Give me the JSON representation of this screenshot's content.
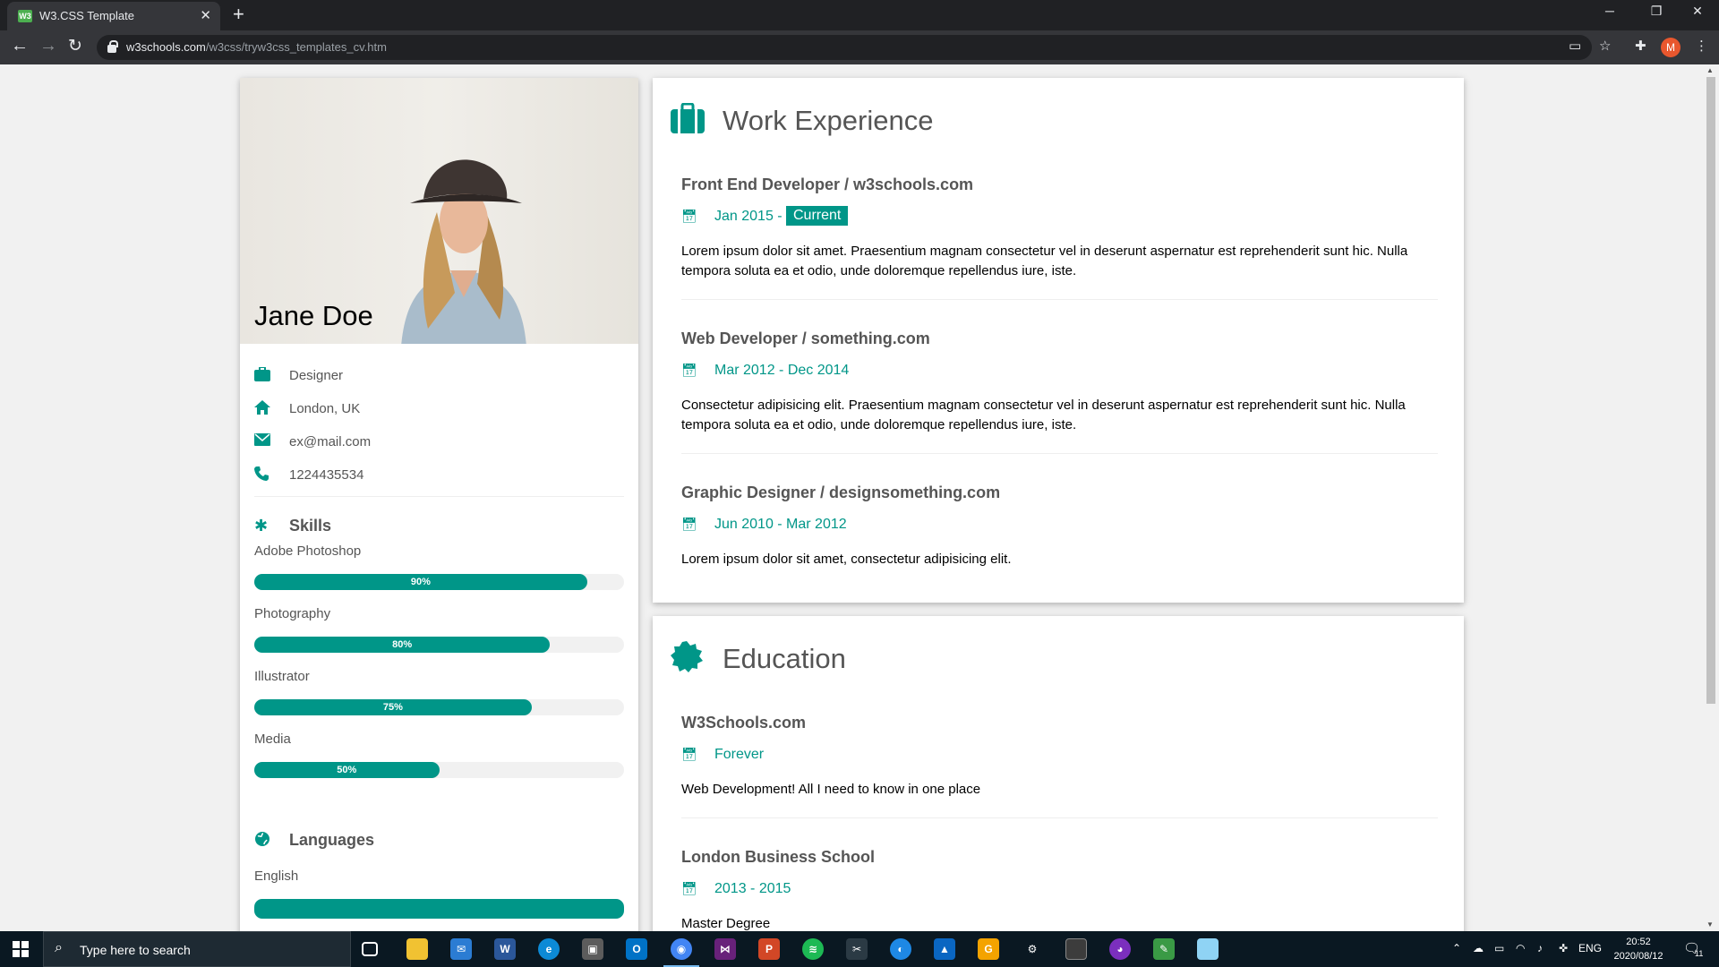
{
  "browser": {
    "tab_title": "W3.CSS Template",
    "tab_close": "✕",
    "new_tab": "+",
    "url_host": "w3schools.com",
    "url_path": "/w3css/tryw3css_templates_cv.htm",
    "profile_initial": "M",
    "window": {
      "minimize": "─",
      "restore": "❐",
      "close": "✕"
    }
  },
  "profile": {
    "name": "Jane Doe",
    "job": "Designer",
    "location": "London, UK",
    "email": "ex@mail.com",
    "phone": "1224435534"
  },
  "skills": {
    "heading": "Skills",
    "items": [
      {
        "label": "Adobe Photoshop",
        "percent_text": "90%",
        "value": 0.9
      },
      {
        "label": "Photography",
        "percent_text": "80%",
        "value": 0.8
      },
      {
        "label": "Illustrator",
        "percent_text": "75%",
        "value": 0.75
      },
      {
        "label": "Media",
        "percent_text": "50%",
        "value": 0.5
      }
    ]
  },
  "languages": {
    "heading": "Languages",
    "items": [
      {
        "label": "English",
        "value": 1.0
      }
    ]
  },
  "work": {
    "heading": "Work Experience",
    "entries": [
      {
        "title": "Front End Developer / w3schools.com",
        "date": "Jan 2015 -",
        "badge": "Current",
        "desc": "Lorem ipsum dolor sit amet. Praesentium magnam consectetur vel in deserunt aspernatur est reprehenderit sunt hic. Nulla tempora soluta ea et odio, unde doloremque repellendus iure, iste."
      },
      {
        "title": "Web Developer / something.com",
        "date": "Mar 2012 - Dec 2014",
        "desc": "Consectetur adipisicing elit. Praesentium magnam consectetur vel in deserunt aspernatur est reprehenderit sunt hic. Nulla tempora soluta ea et odio, unde doloremque repellendus iure, iste."
      },
      {
        "title": "Graphic Designer / designsomething.com",
        "date": "Jun 2010 - Mar 2012",
        "desc": "Lorem ipsum dolor sit amet, consectetur adipisicing elit."
      }
    ]
  },
  "education": {
    "heading": "Education",
    "entries": [
      {
        "title": "W3Schools.com",
        "date": "Forever",
        "desc": "Web Development! All I need to know in one place"
      },
      {
        "title": "London Business School",
        "date": "2013 - 2015",
        "desc": "Master Degree"
      }
    ]
  },
  "taskbar": {
    "search_placeholder": "Type here to search",
    "language": "ENG",
    "time": "20:52",
    "date": "2020/08/12",
    "notifications": "11"
  },
  "colors": {
    "accent": "#009688",
    "page_bg": "#f1f1f1",
    "chrome_dark": "#202124",
    "taskbar": "#0a1822"
  }
}
